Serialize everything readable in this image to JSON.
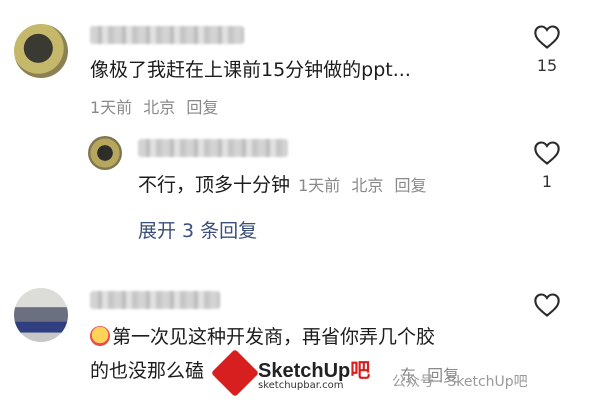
{
  "comments": [
    {
      "text": "像极了我赶在上课前15分钟做的ppt...",
      "time": "1天前",
      "location": "北京",
      "reply": "回复",
      "likes": "15"
    },
    {
      "text": "不行，顶多十分钟",
      "time": "1天前",
      "location": "北京",
      "reply": "回复",
      "likes": "1"
    },
    {
      "text_line1": "第一次见这种开发商，再省你弄几个胶",
      "text_line2": "的也没那么磕",
      "location_tail": "东",
      "reply": "回复"
    }
  ],
  "expand_label": "展开 3 条回复",
  "watermark": {
    "title_a": "SketchUp",
    "title_b": "吧",
    "subtitle": "sketchupbar.com",
    "account": "公众号 · SketchUp吧"
  }
}
